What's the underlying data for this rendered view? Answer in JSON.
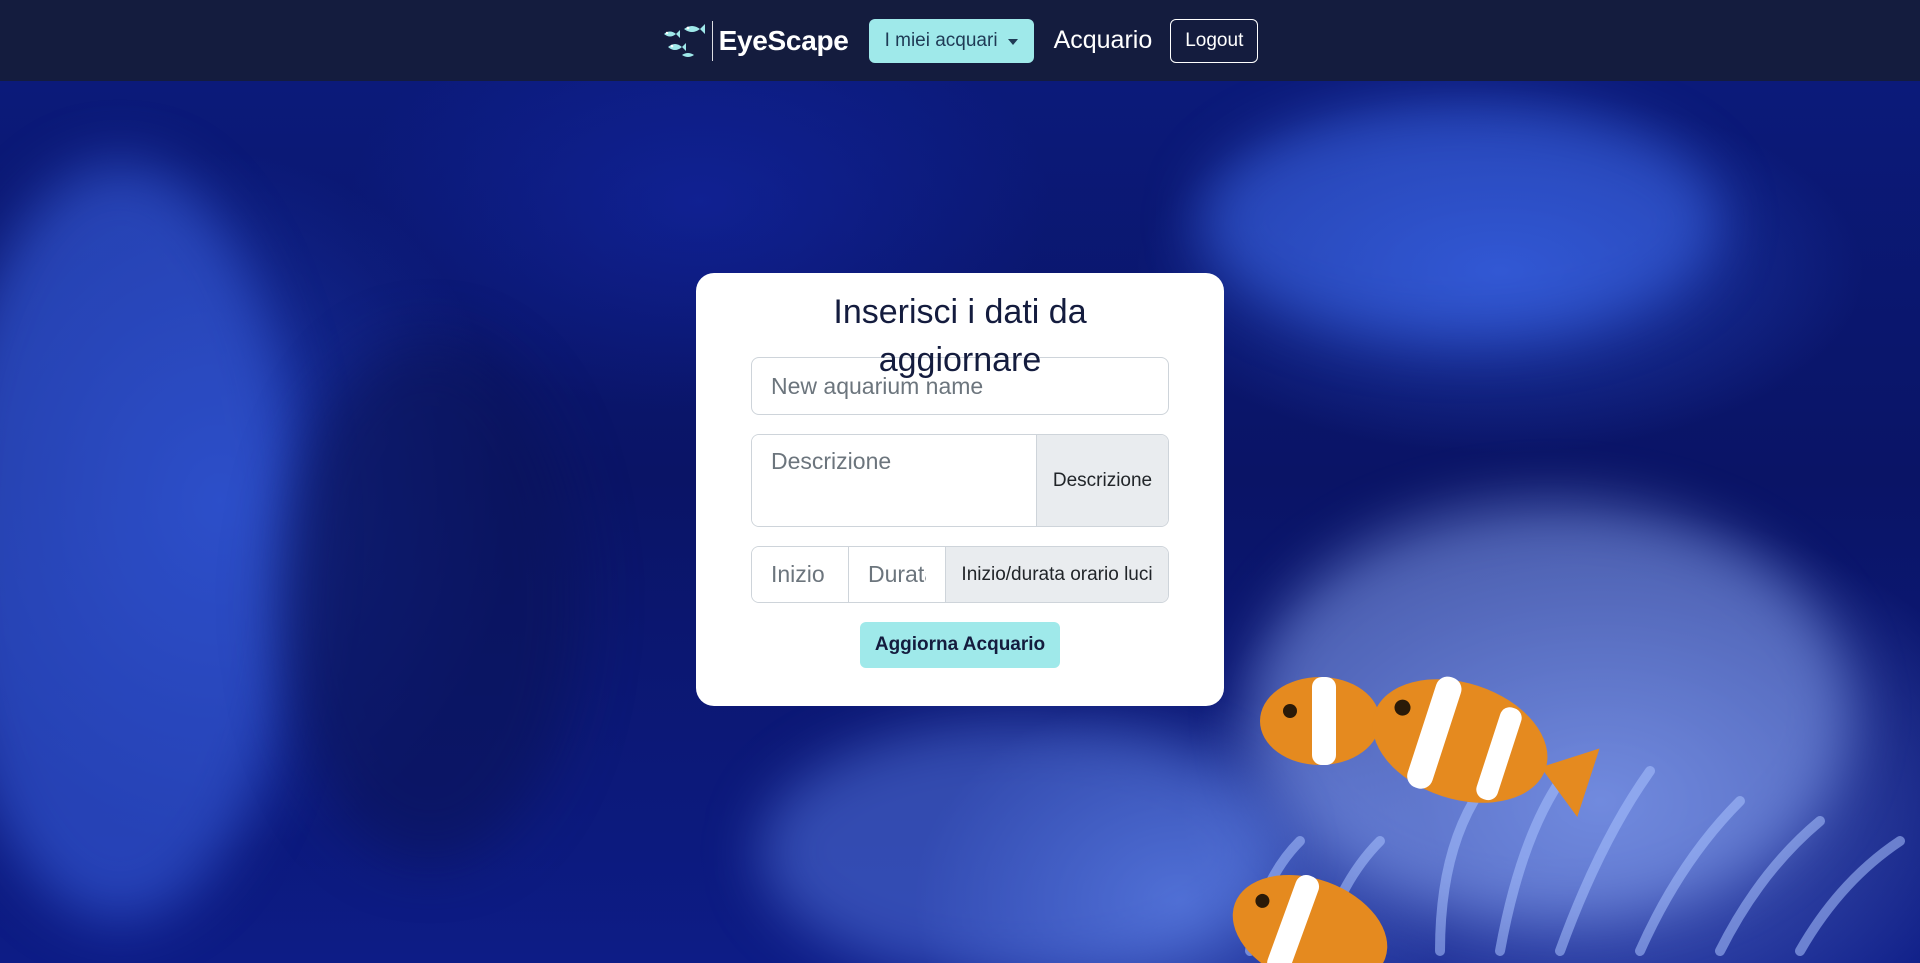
{
  "navbar": {
    "brand_name": "EyeScape",
    "dropdown_label": "I miei acquari",
    "nav_link": "Acquario",
    "logout_label": "Logout"
  },
  "form": {
    "title": "Inserisci i dati da aggiornare",
    "name_placeholder": "New aquarium name",
    "description_placeholder": "Descrizione",
    "description_addon": "Descrizione",
    "start_placeholder": "Inizio",
    "duration_placeholder": "Durata",
    "lights_addon": "Inizio/durata orario luci",
    "submit_label": "Aggiorna Acquario"
  },
  "colors": {
    "navbar_bg": "#141c3e",
    "accent": "#9fe9ea",
    "card_bg": "#ffffff"
  },
  "icons": {
    "brand_logo": "fish-logo-icon",
    "dropdown_caret": "caret-down-icon"
  }
}
